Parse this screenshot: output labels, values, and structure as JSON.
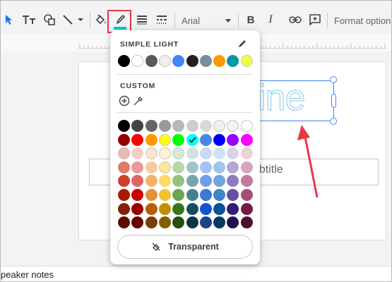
{
  "toolbar": {
    "font_name": "Arial",
    "format_options": "Format option",
    "text_color_indicator": "#00c9d4",
    "highlight_color": "#e8374a",
    "icons": [
      "select-pointer-icon",
      "textbox-icon",
      "shapes-icon",
      "line-icon",
      "fill-color-icon",
      "border-color-icon",
      "border-weight-icon",
      "border-dash-icon",
      "bold-icon",
      "italic-icon",
      "link-icon",
      "comment-icon"
    ],
    "bold_label": "B",
    "italic_label": "I"
  },
  "slide": {
    "title_text": "ine",
    "subtitle_text": "ubtitle"
  },
  "notes": {
    "label": "peaker notes"
  },
  "popup": {
    "simple_light_label": "SIMPLE LIGHT",
    "custom_label": "CUSTOM",
    "transparent_label": "Transparent",
    "theme_colors": [
      "#000000",
      "#ffffff",
      "#595959",
      "#eeeeee",
      "#4285f4",
      "#212121",
      "#78909c",
      "#ff9800",
      "#0097a7",
      "#eeff41"
    ],
    "selected_color": "#00ffff",
    "grid_colors": [
      [
        "#000000",
        "#434343",
        "#666666",
        "#999999",
        "#b7b7b7",
        "#cccccc",
        "#d9d9d9",
        "#efefef",
        "#f3f3f3",
        "#ffffff"
      ],
      [
        "#980000",
        "#ff0000",
        "#ff9900",
        "#ffff00",
        "#00ff00",
        "#00ffff",
        "#4a86e8",
        "#0000ff",
        "#9900ff",
        "#ff00ff"
      ],
      [
        "#e6b8af",
        "#f4cccc",
        "#fce5cd",
        "#fff2cc",
        "#d9ead3",
        "#d0e0e3",
        "#c9daf8",
        "#cfe2f3",
        "#d9d2e9",
        "#ead1dc"
      ],
      [
        "#dd7e6b",
        "#ea9999",
        "#f9cb9c",
        "#ffe599",
        "#b6d7a8",
        "#a2c4c9",
        "#a4c2f4",
        "#9fc5e8",
        "#b4a7d6",
        "#d5a6bd"
      ],
      [
        "#cc4125",
        "#e06666",
        "#f6b26b",
        "#ffd966",
        "#93c47d",
        "#76a5af",
        "#6d9eeb",
        "#6fa8dc",
        "#8e7cc3",
        "#c27ba0"
      ],
      [
        "#a61c00",
        "#cc0000",
        "#e69138",
        "#f1c232",
        "#6aa84f",
        "#45818e",
        "#3c78d8",
        "#3d85c6",
        "#674ea7",
        "#a64d79"
      ],
      [
        "#85200c",
        "#990000",
        "#b45f06",
        "#bf9000",
        "#38761d",
        "#134f5c",
        "#1155cc",
        "#0b5394",
        "#351c75",
        "#741b47"
      ],
      [
        "#5b0f00",
        "#660000",
        "#783f04",
        "#7f6000",
        "#274e13",
        "#0c343d",
        "#1c4587",
        "#073763",
        "#20124d",
        "#4c1130"
      ]
    ]
  },
  "annotation": {
    "arrow_color": "#e8374a"
  }
}
